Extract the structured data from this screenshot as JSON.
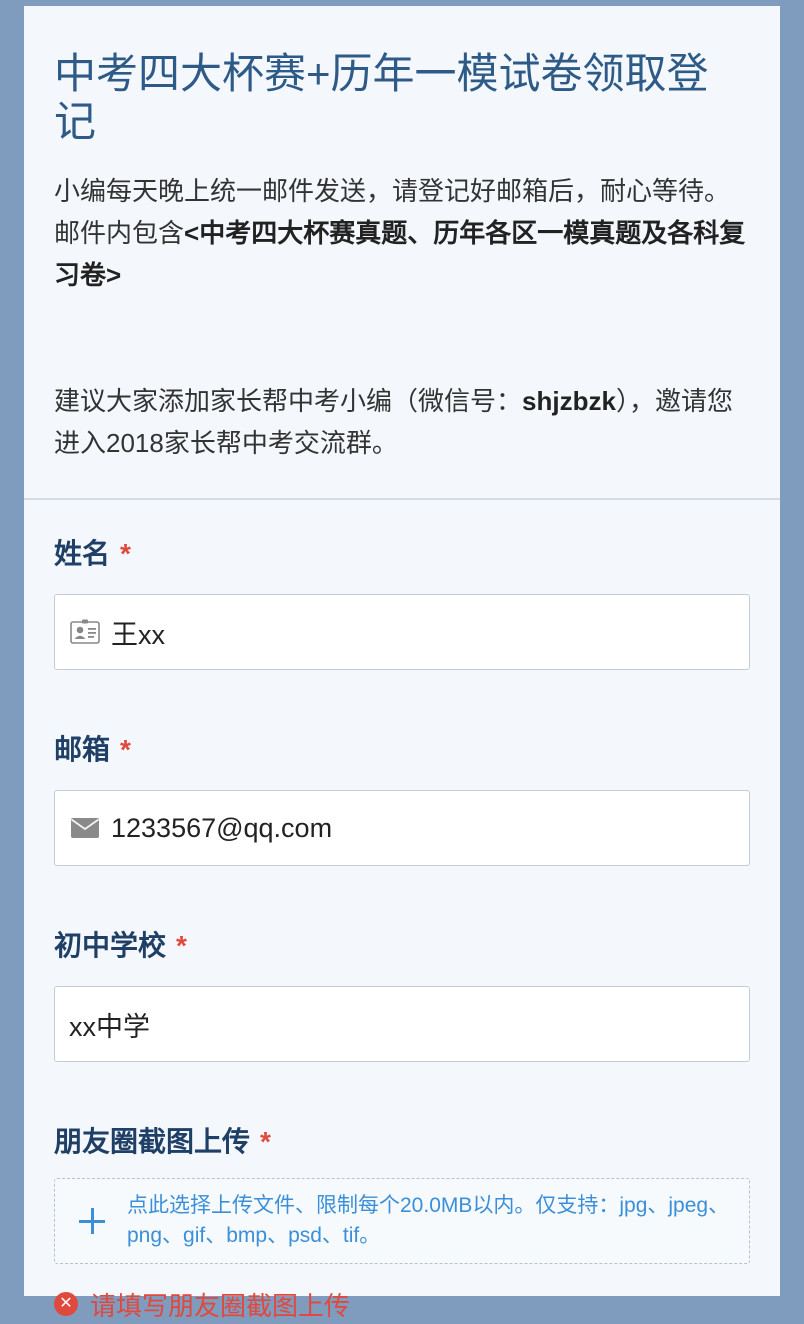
{
  "header": {
    "title": "中考四大杯赛+历年一模试卷领取登记",
    "desc_plain": "小编每天晚上统一邮件发送，请登记好邮箱后，耐心等待。邮件内包含",
    "desc_bold": "<中考四大杯赛真题、历年各区一模真题及各科复习卷>",
    "note_pre": "建议大家添加家长帮中考小编（微信号：",
    "note_bold": "shjzbzk",
    "note_post": "），邀请您进入2018家长帮中考交流群。"
  },
  "form": {
    "required_mark": "*",
    "name": {
      "label": "姓名",
      "value": "王xx",
      "icon": "id-card-icon"
    },
    "email": {
      "label": "邮箱",
      "value": "1233567@qq.com",
      "icon": "envelope-icon"
    },
    "school": {
      "label": "初中学校",
      "value": "xx中学"
    },
    "screenshot": {
      "label": "朋友圈截图上传",
      "upload_hint": "点此选择上传文件、限制每个20.0MB以内。仅支持：jpg、jpeg、png、gif、bmp、psd、tif。",
      "error_text": "请填写朋友圈截图上传",
      "icon": "plus-icon"
    }
  },
  "colors": {
    "page_bg": "#7f9cbe",
    "title": "#2d5a86",
    "label": "#1f3f66",
    "required": "#e0493d",
    "link": "#3b8fd9"
  }
}
